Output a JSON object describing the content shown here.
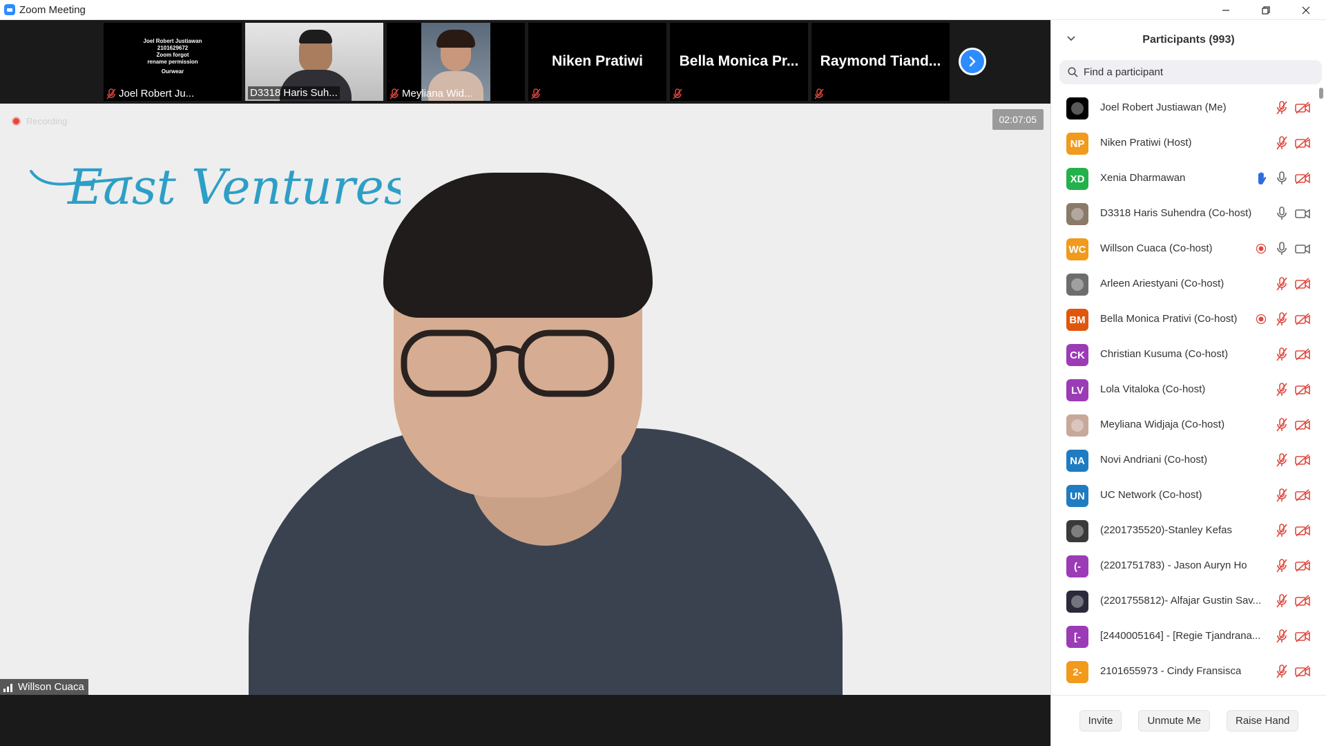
{
  "window": {
    "title": "Zoom Meeting"
  },
  "thumbnails": [
    {
      "name": "Joel Robert Ju...",
      "muted": true,
      "card_lines": [
        "Joel Robert Justiawan",
        "2101629672",
        "Zoom forgot",
        "rename permission",
        "Ourwear"
      ]
    },
    {
      "name": "D3318 Haris Suh...",
      "muted": false
    },
    {
      "name": "Meyliana Wid...",
      "muted": true
    },
    {
      "name": "Niken Pratiwi",
      "muted": true
    },
    {
      "name": "Bella Monica Pr...",
      "muted": true
    },
    {
      "name": "Raymond Tiand...",
      "muted": true
    }
  ],
  "main": {
    "recording_label": "Recording",
    "timer": "02:07:05",
    "speaker_name": "Willson Cuaca",
    "logo_text": "East Ventures"
  },
  "panel": {
    "title": "Participants (993)",
    "search_placeholder": "Find a participant",
    "participants": [
      {
        "name": "Joel Robert Justiawan (Me)",
        "avatar_type": "image",
        "initials": "",
        "color": "#000000",
        "raised_hand": false,
        "recording": false,
        "mic": "off",
        "video": "off"
      },
      {
        "name": "Niken Pratiwi (Host)",
        "avatar_type": "initials",
        "initials": "NP",
        "color": "#f19a1c",
        "raised_hand": false,
        "recording": false,
        "mic": "off",
        "video": "off"
      },
      {
        "name": "Xenia Dharmawan",
        "avatar_type": "initials",
        "initials": "XD",
        "color": "#23b14b",
        "raised_hand": true,
        "recording": false,
        "mic": "on",
        "video": "off"
      },
      {
        "name": "D3318 Haris Suhendra (Co-host)",
        "avatar_type": "image",
        "initials": "",
        "color": "#8a7a6a",
        "raised_hand": false,
        "recording": false,
        "mic": "on",
        "video": "on"
      },
      {
        "name": "Willson Cuaca (Co-host)",
        "avatar_type": "initials",
        "initials": "WC",
        "color": "#f19a1c",
        "raised_hand": false,
        "recording": true,
        "mic": "on",
        "video": "on"
      },
      {
        "name": "Arleen Ariestyani (Co-host)",
        "avatar_type": "image",
        "initials": "",
        "color": "#6d6d6d",
        "raised_hand": false,
        "recording": false,
        "mic": "off",
        "video": "off"
      },
      {
        "name": "Bella Monica Prativi (Co-host)",
        "avatar_type": "initials",
        "initials": "BM",
        "color": "#e0560c",
        "raised_hand": false,
        "recording": true,
        "mic": "off",
        "video": "off"
      },
      {
        "name": "Christian Kusuma (Co-host)",
        "avatar_type": "initials",
        "initials": "CK",
        "color": "#9b3bb6",
        "raised_hand": false,
        "recording": false,
        "mic": "off",
        "video": "off"
      },
      {
        "name": "Lola Vitaloka (Co-host)",
        "avatar_type": "initials",
        "initials": "LV",
        "color": "#9b3bb6",
        "raised_hand": false,
        "recording": false,
        "mic": "off",
        "video": "off"
      },
      {
        "name": "Meyliana Widjaja (Co-host)",
        "avatar_type": "image",
        "initials": "",
        "color": "#c7a89a",
        "raised_hand": false,
        "recording": false,
        "mic": "off",
        "video": "off"
      },
      {
        "name": "Novi Andriani (Co-host)",
        "avatar_type": "initials",
        "initials": "NA",
        "color": "#1f7cc0",
        "raised_hand": false,
        "recording": false,
        "mic": "off",
        "video": "off"
      },
      {
        "name": "UC Network (Co-host)",
        "avatar_type": "initials",
        "initials": "UN",
        "color": "#1f7cc0",
        "raised_hand": false,
        "recording": false,
        "mic": "off",
        "video": "off"
      },
      {
        "name": "(2201735520)-Stanley Kefas",
        "avatar_type": "image",
        "initials": "",
        "color": "#3a3a3a",
        "raised_hand": false,
        "recording": false,
        "mic": "off",
        "video": "off"
      },
      {
        "name": "(2201751783) - Jason Auryn Ho",
        "avatar_type": "initials",
        "initials": "(-",
        "color": "#9b3bb6",
        "raised_hand": false,
        "recording": false,
        "mic": "off",
        "video": "off"
      },
      {
        "name": "(2201755812)- Alfajar Gustin Sav...",
        "avatar_type": "image",
        "initials": "",
        "color": "#2a2a3a",
        "raised_hand": false,
        "recording": false,
        "mic": "off",
        "video": "off"
      },
      {
        "name": "[2440005164] - [Regie Tjandrana...",
        "avatar_type": "initials",
        "initials": "[-",
        "color": "#9b3bb6",
        "raised_hand": false,
        "recording": false,
        "mic": "off",
        "video": "off"
      },
      {
        "name": "2101655973 - Cindy Fransisca",
        "avatar_type": "initials",
        "initials": "2-",
        "color": "#f19a1c",
        "raised_hand": false,
        "recording": false,
        "mic": "off",
        "video": "off"
      }
    ],
    "footer": {
      "invite": "Invite",
      "unmute": "Unmute Me",
      "raise_hand": "Raise Hand"
    }
  }
}
